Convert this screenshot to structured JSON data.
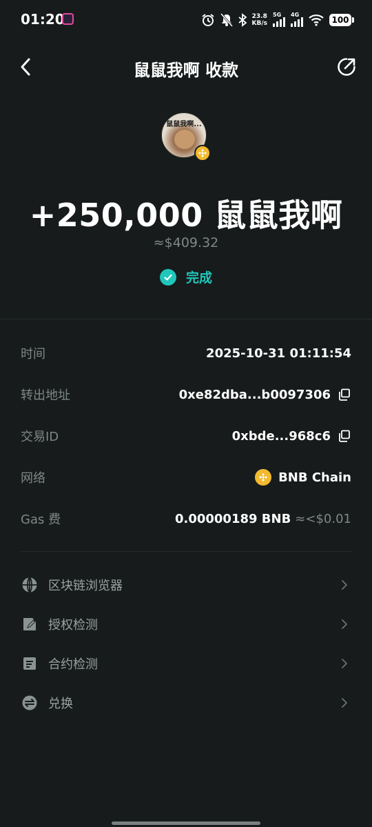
{
  "status_bar": {
    "time": "01:20",
    "net_speed_value": "23.8",
    "net_speed_unit": "KB/s",
    "sim1_label": "5G",
    "sim2_label": "4G",
    "battery": "100"
  },
  "header": {
    "title": "鼠鼠我啊 收款",
    "back_icon": "chevron-left-icon",
    "share_icon": "share-arrow-icon"
  },
  "token": {
    "avatar_caption": "鼠鼠我啊...",
    "amount": "+250,000 鼠鼠我啊",
    "fiat_value": "≈$409.32",
    "status": "完成",
    "status_color": "#20c6bb"
  },
  "details": {
    "time_label": "时间",
    "time_value": "2025-10-31 01:11:54",
    "from_label": "转出地址",
    "from_value": "0xe82dba...b0097306",
    "txid_label": "交易ID",
    "txid_value": "0xbde...968c6",
    "network_label": "网络",
    "network_value": "BNB Chain",
    "gas_label": "Gas 费",
    "gas_value": "0.00000189 BNB",
    "gas_fiat": "≈<$0.01"
  },
  "links": [
    {
      "label": "区块链浏览器",
      "icon": "globe-icon"
    },
    {
      "label": "授权检测",
      "icon": "edit-document-icon"
    },
    {
      "label": "合约检测",
      "icon": "document-icon"
    },
    {
      "label": "兑换",
      "icon": "swap-icon"
    }
  ],
  "colors": {
    "background": "#171b1b",
    "accent": "#20c6bb",
    "bnb": "#f3ba2f"
  }
}
